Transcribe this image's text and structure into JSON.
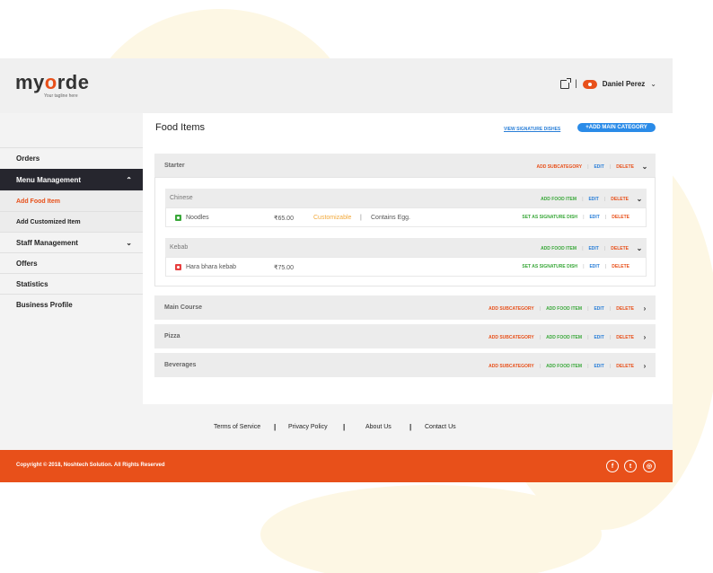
{
  "brand": {
    "logo_text_pre": "my",
    "logo_text_o": "o",
    "logo_text_post": "rde",
    "tagline": "Your tagline here"
  },
  "header": {
    "separator": "|",
    "user_name": "Daniel Perez"
  },
  "sidebar": {
    "items": [
      {
        "label": "Orders"
      },
      {
        "label": "Menu Management",
        "caret": "⌃"
      },
      {
        "label": "Add Food Item"
      },
      {
        "label": "Add Customized Item"
      },
      {
        "label": "Staff Management",
        "caret": "⌄"
      },
      {
        "label": "Offers"
      },
      {
        "label": "Statistics"
      },
      {
        "label": "Business Profile"
      }
    ]
  },
  "main": {
    "title": "Food Items",
    "view_signature": "VIEW SIGNATURE DISHES",
    "add_main_category": "+ADD MAIN CATEGORY",
    "categories": [
      {
        "name": "Starter",
        "add_sub": "ADD SUBCATEGORY",
        "edit": "EDIT",
        "delete": "DELETE",
        "subcategories": [
          {
            "name": "Chinese",
            "add_food": "ADD FOOD ITEM",
            "edit": "EDIT",
            "delete": "DELETE",
            "items": [
              {
                "name": "Noodles",
                "price": "₹65.00",
                "custom": "Customizable",
                "pipe": "|",
                "note": "Contains Egg.",
                "signature": "SET AS SIGNATURE DISH",
                "edit": "EDIT",
                "delete": "DELETE"
              }
            ]
          },
          {
            "name": "Kebab",
            "add_food": "ADD FOOD ITEM",
            "edit": "EDIT",
            "delete": "DELETE",
            "items": [
              {
                "name": "Hara bhara kebab",
                "price": "₹75.00",
                "signature": "SET AS SIGNATURE DISH",
                "edit": "EDIT",
                "delete": "DELETE"
              }
            ]
          }
        ]
      },
      {
        "name": "Main Course",
        "add_sub": "ADD SUBCATEGORY",
        "add_food": "ADD FOOD ITEM",
        "edit": "EDIT",
        "delete": "DELETE"
      },
      {
        "name": "Pizza",
        "add_sub": "ADD SUBCATEGORY",
        "add_food": "ADD FOOD ITEM",
        "edit": "EDIT",
        "delete": "DELETE"
      },
      {
        "name": "Beverages",
        "add_sub": "ADD SUBCATEGORY",
        "add_food": "ADD FOOD ITEM",
        "edit": "EDIT",
        "delete": "DELETE"
      }
    ]
  },
  "footer": {
    "links": [
      "Terms of Service",
      "Privacy Policy",
      "About Us",
      "Contact Us"
    ],
    "separator": "|",
    "copyright": "Copyright © 2018, Noshtech Solution. All Rights Reserved",
    "social": [
      {
        "icon": "facebook-icon",
        "glyph": "f"
      },
      {
        "icon": "twitter-icon",
        "glyph": "t"
      },
      {
        "icon": "instagram-icon",
        "glyph": "◎"
      }
    ]
  },
  "colors": {
    "accent": "#e8501a",
    "blue": "#2a8be8",
    "green": "#3aa83a",
    "dark": "#26262e"
  }
}
